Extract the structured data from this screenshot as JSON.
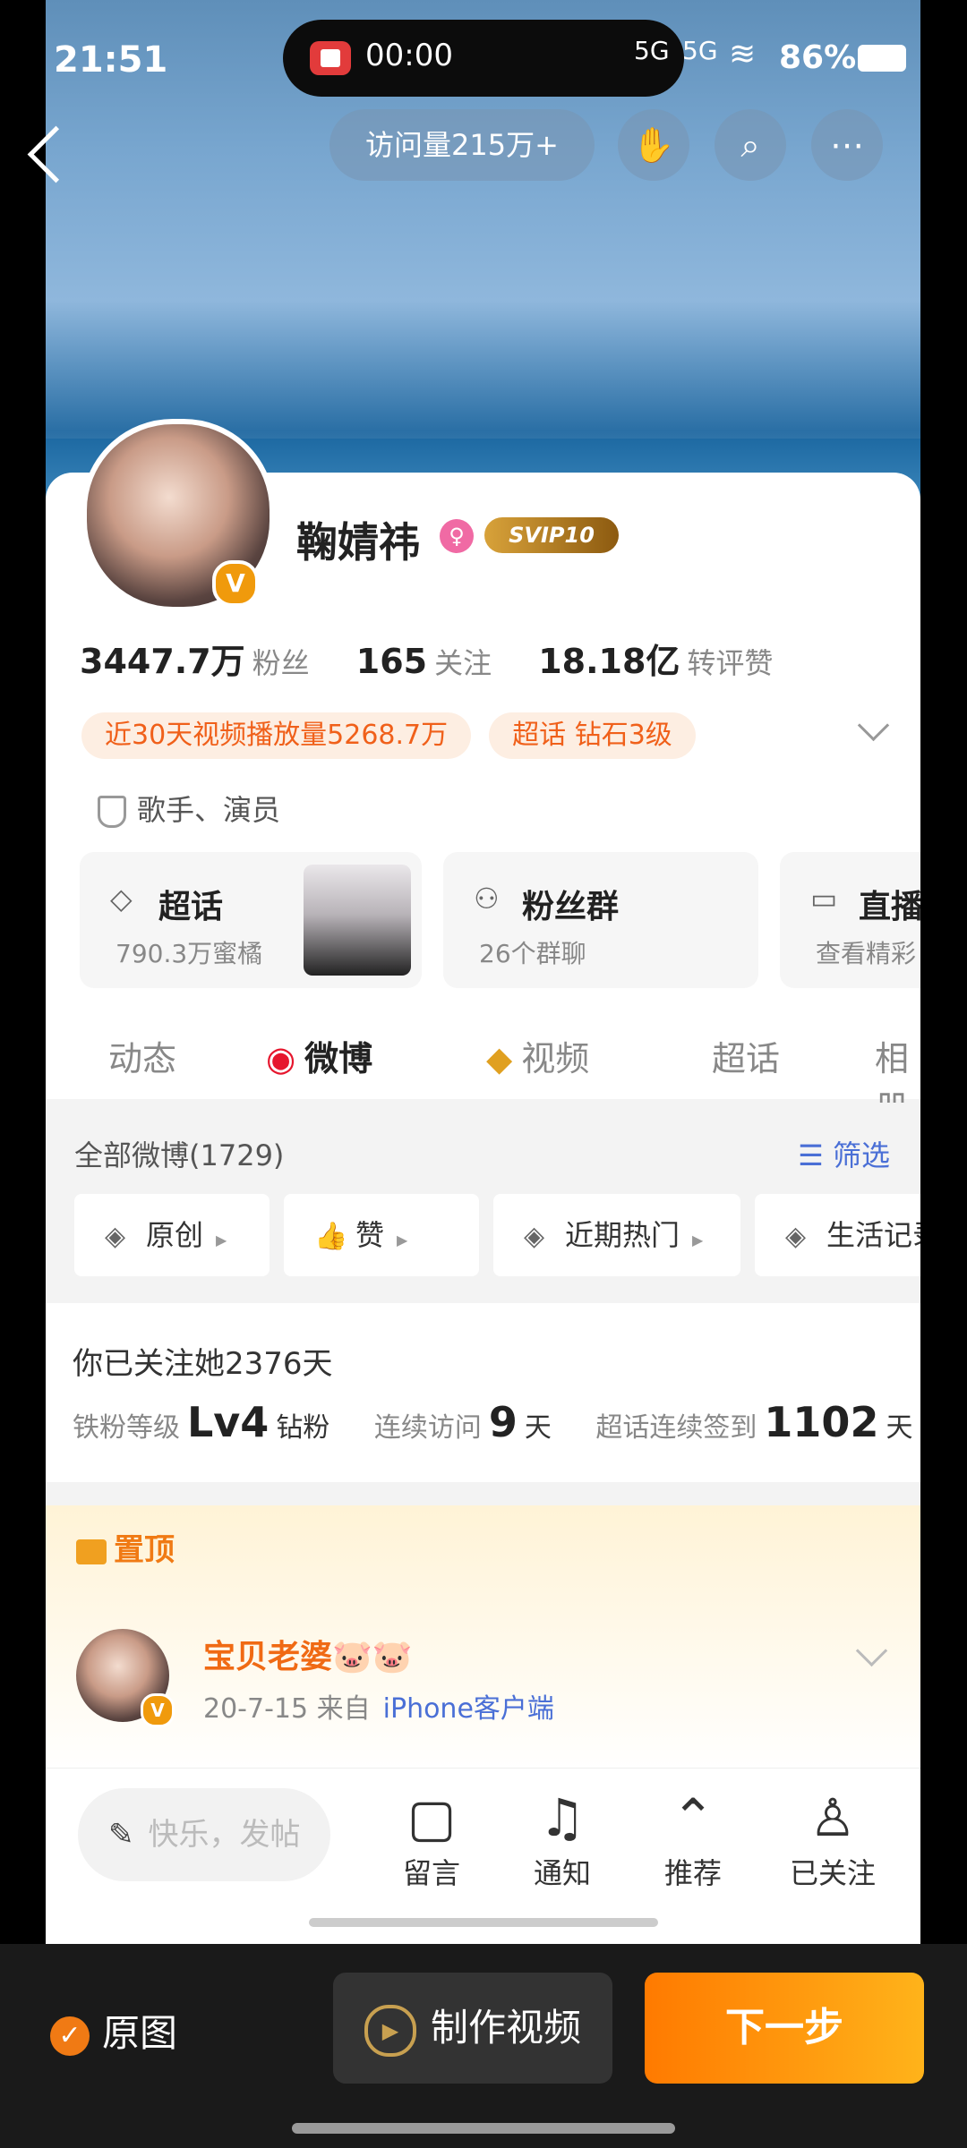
{
  "status": {
    "time": "21:51",
    "record_time": "00:00",
    "battery": "86%",
    "net1": "5G",
    "net2": "5G"
  },
  "nav": {
    "visits": "访问量215万+",
    "donut_icon": "hand-icon",
    "search_icon": "search-icon",
    "more_icon": "more-icon"
  },
  "profile": {
    "name": "鞠婧祎",
    "vip": "SVIP10",
    "followers_num": "3447.7万",
    "followers_label": "粉丝",
    "following_num": "165",
    "following_label": "关注",
    "likes_num": "18.18亿",
    "likes_label": "转评赞",
    "tags": [
      "近30天视频播放量5268.7万",
      "超话 钻石3级"
    ],
    "profession": "歌手、演员"
  },
  "cards": [
    {
      "title": "超话",
      "sub": "790.3万蜜橘"
    },
    {
      "title": "粉丝群",
      "sub": "26个群聊"
    },
    {
      "title": "直播",
      "sub": "查看精彩"
    }
  ],
  "tabs": [
    "动态",
    "微博",
    "视频",
    "超话",
    "相册"
  ],
  "filter": {
    "title": "全部微博(1729)",
    "select": "筛选",
    "buttons": [
      "原创",
      "赞",
      "近期热门",
      "生活记录"
    ]
  },
  "fans": {
    "follow_days": "你已关注她2376天",
    "level_label": "铁粉等级",
    "level_value": "Lv4",
    "level_unit": "钻粉",
    "visit_label": "连续访问",
    "visit_value": "9",
    "visit_unit": "天",
    "sign_label": "超话连续签到",
    "sign_value": "1102",
    "sign_unit": "天"
  },
  "pinned": {
    "label": "置顶",
    "author": "宝贝老婆🐷🐷",
    "date": "20-7-15",
    "source_prefix": "来自",
    "source": "iPhone客户端"
  },
  "bottom": {
    "compose_placeholder": "快乐，发帖",
    "items": [
      "留言",
      "通知",
      "推荐",
      "已关注"
    ]
  },
  "footer": {
    "original": "原图",
    "make_video": "制作视频",
    "next": "下一步"
  }
}
